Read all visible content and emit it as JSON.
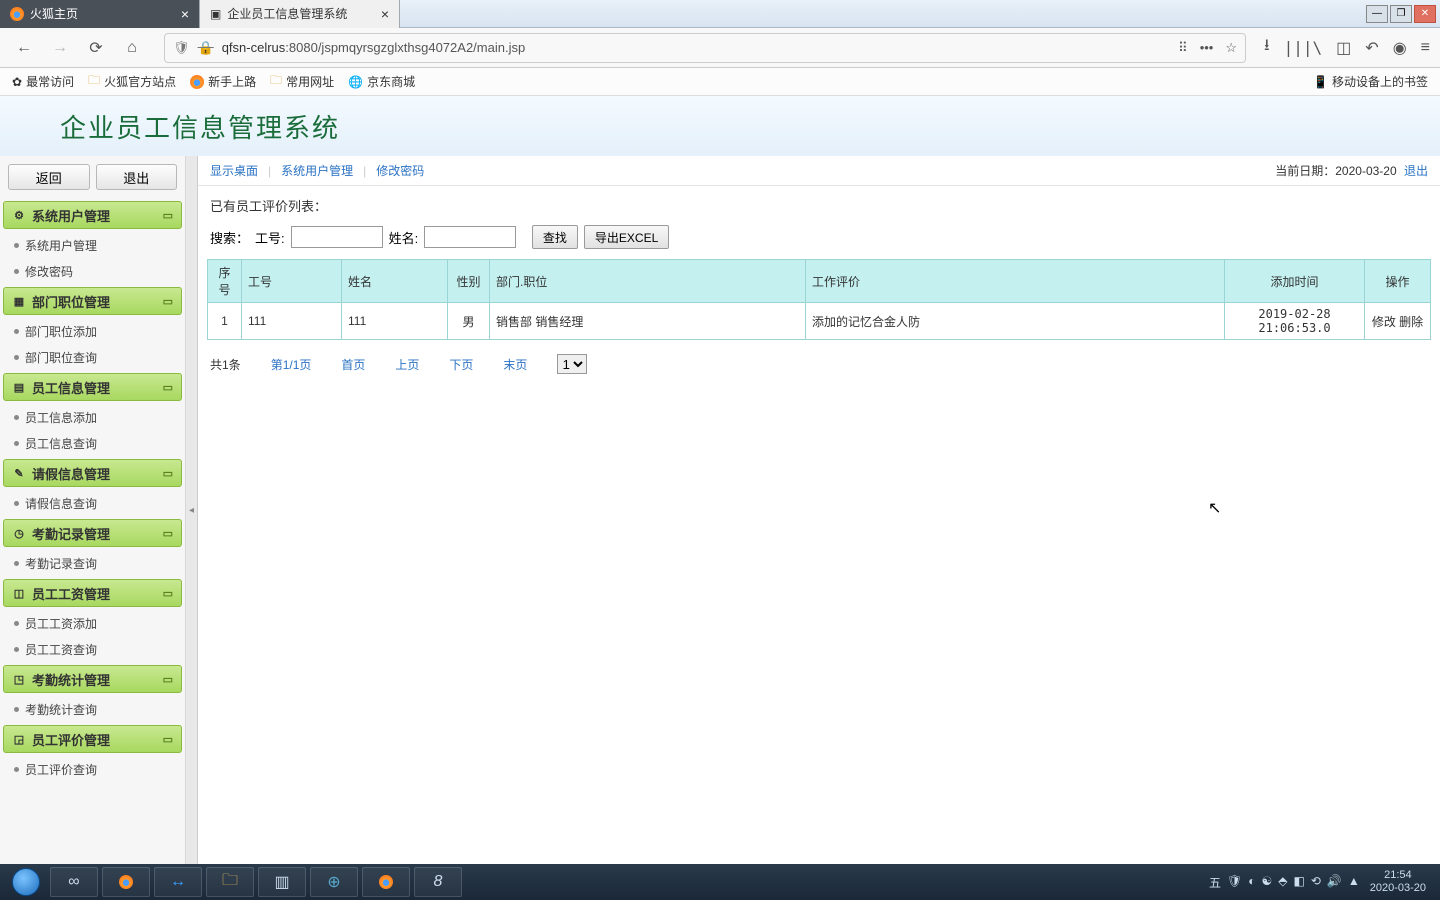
{
  "tabs": {
    "t1": "火狐主页",
    "t2": "企业员工信息管理系统"
  },
  "url": {
    "host": "qfsn-celrus",
    "rest": ":8080/jspmqyrsgzglxthsg4072A2/main.jsp"
  },
  "bookmarks": {
    "b1": "最常访问",
    "b2": "火狐官方站点",
    "b3": "新手上路",
    "b4": "常用网址",
    "b5": "京东商城",
    "mobile": "移动设备上的书签"
  },
  "app": {
    "title": "企业员工信息管理系统"
  },
  "sideTop": {
    "back": "返回",
    "exit": "退出"
  },
  "menus": {
    "g1": "系统用户管理",
    "g1i1": "系统用户管理",
    "g1i2": "修改密码",
    "g2": "部门职位管理",
    "g2i1": "部门职位添加",
    "g2i2": "部门职位查询",
    "g3": "员工信息管理",
    "g3i1": "员工信息添加",
    "g3i2": "员工信息查询",
    "g4": "请假信息管理",
    "g4i1": "请假信息查询",
    "g5": "考勤记录管理",
    "g5i1": "考勤记录查询",
    "g6": "员工工资管理",
    "g6i1": "员工工资添加",
    "g6i2": "员工工资查询",
    "g7": "考勤统计管理",
    "g7i1": "考勤统计查询",
    "g8": "员工评价管理",
    "g8i1": "员工评价查询"
  },
  "crumbs": {
    "c1": "显示桌面",
    "c2": "系统用户管理",
    "c3": "修改密码",
    "dateLabel": "当前日期：",
    "date": "2020-03-20",
    "logout": "退出"
  },
  "list": {
    "title": "已有员工评价列表："
  },
  "search": {
    "label": "搜索：",
    "f1": "工号:",
    "f2": "姓名:",
    "find": "查找",
    "export": "导出EXCEL"
  },
  "table": {
    "h1": "序号",
    "h2": "工号",
    "h3": "姓名",
    "h4": "性别",
    "h5": "部门.职位",
    "h6": "工作评价",
    "h7": "添加时间",
    "h8": "操作",
    "r1c1": "1",
    "r1c2": "111",
    "r1c3": "111",
    "r1c4": "男",
    "r1c5": "销售部 销售经理",
    "r1c6": "添加的记忆合金人防",
    "r1c7": "2019-02-28 21:06:53.0",
    "r1edit": "修改",
    "r1del": "删除"
  },
  "pager": {
    "total": "共1条",
    "page": "第1/1页",
    "first": "首页",
    "prev": "上页",
    "next": "下页",
    "last": "末页",
    "sel": "1"
  },
  "taskbar": {
    "time": "21:54",
    "date": "2020-03-20"
  }
}
